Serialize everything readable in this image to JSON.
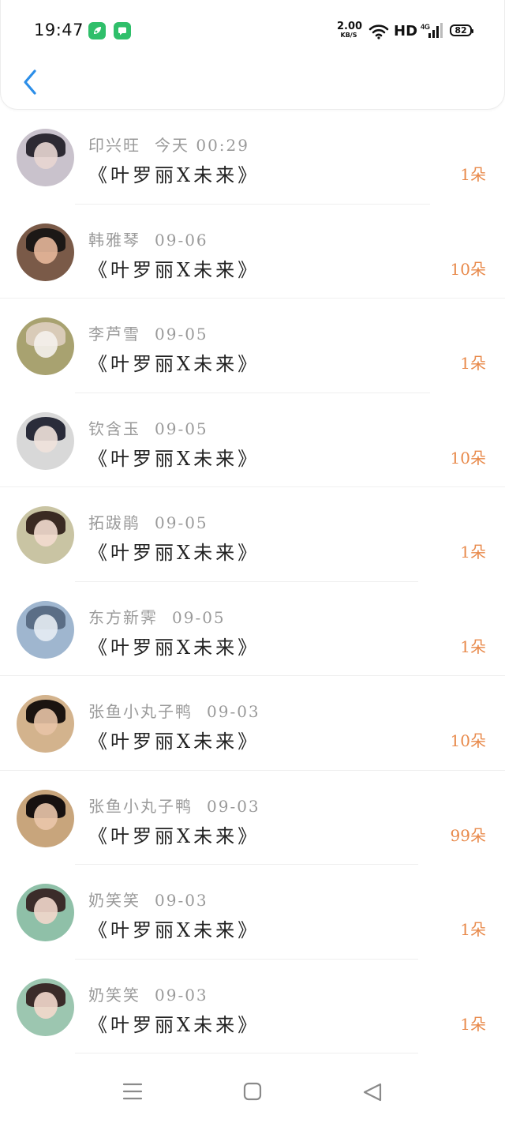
{
  "status_bar": {
    "time": "19:47",
    "app_icons": [
      "leaf-app-icon",
      "message-app-icon"
    ],
    "net_speed": "2.00",
    "net_unit": "KB/S",
    "hd": "HD",
    "network": "4G",
    "battery": "82"
  },
  "header": {
    "back_icon": "chevron-left-icon",
    "accent": "#2c8ee8"
  },
  "records": [
    {
      "name": "印兴旺",
      "date": "今天 00:29",
      "title": "《叶罗丽X未来》",
      "count": "1朵",
      "avatar": [
        "#c9c2cc",
        "#e8d6d2",
        "#2d2a33"
      ]
    },
    {
      "name": "韩雅琴",
      "date": "09-06",
      "title": "《叶罗丽X未来》",
      "count": "10朵",
      "avatar": [
        "#7a5a48",
        "#e7b79a",
        "#1c1816"
      ]
    },
    {
      "name": "李芦雪",
      "date": "09-05",
      "title": "《叶罗丽X未来》",
      "count": "1朵",
      "avatar": [
        "#a8a270",
        "#f4f1ec",
        "#d9cbb8"
      ]
    },
    {
      "name": "钦含玉",
      "date": "09-05",
      "title": "《叶罗丽X未来》",
      "count": "10朵",
      "avatar": [
        "#d8d8d8",
        "#f0e2db",
        "#2a2c3a"
      ]
    },
    {
      "name": "拓跋鹃",
      "date": "09-05",
      "title": "《叶罗丽X未来》",
      "count": "1朵",
      "avatar": [
        "#c9c4a3",
        "#f3dccf",
        "#3a2a22"
      ]
    },
    {
      "name": "东方新霁",
      "date": "09-05",
      "title": "《叶罗丽X未来》",
      "count": "1朵",
      "avatar": [
        "#9fb6cf",
        "#e6ecf3",
        "#5b6e86"
      ]
    },
    {
      "name": "张鱼小丸子鸭",
      "date": "09-03",
      "title": "《叶罗丽X未来》",
      "count": "10朵",
      "avatar": [
        "#d3b38d",
        "#e8c3a6",
        "#1b1410"
      ]
    },
    {
      "name": "张鱼小丸子鸭",
      "date": "09-03",
      "title": "《叶罗丽X未来》",
      "count": "99朵",
      "avatar": [
        "#c8a57c",
        "#eac6ab",
        "#171110"
      ]
    },
    {
      "name": "奶笑笑",
      "date": "09-03",
      "title": "《叶罗丽X未来》",
      "count": "1朵",
      "avatar": [
        "#8fc0a8",
        "#f2d7cb",
        "#3b2c2a"
      ]
    },
    {
      "name": "奶笑笑",
      "date": "09-03",
      "title": "《叶罗丽X未来》",
      "count": "1朵",
      "avatar": [
        "#9cc6b0",
        "#f3d8cc",
        "#3a2b29"
      ]
    }
  ],
  "count_color": "#e8894a",
  "nav_bar": [
    "menu-icon",
    "home-square-icon",
    "back-triangle-icon"
  ]
}
